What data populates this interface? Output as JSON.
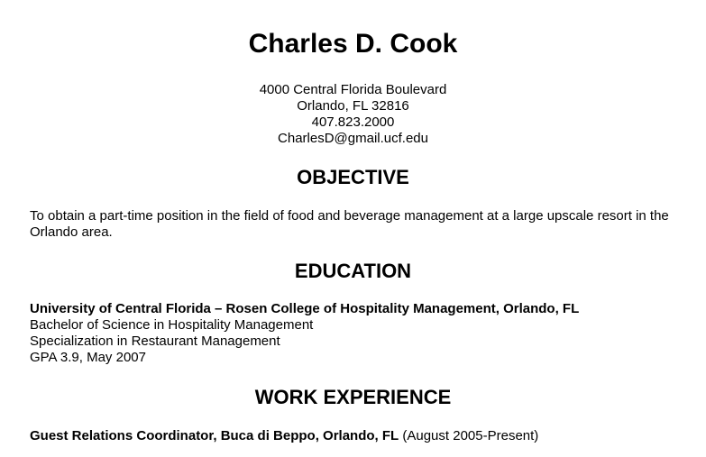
{
  "header": {
    "name": "Charles D. Cook",
    "address_line1": "4000 Central Florida Boulevard",
    "address_line2": "Orlando, FL 32816",
    "phone": "407.823.2000",
    "email": "CharlesD@gmail.ucf.edu"
  },
  "objective": {
    "heading": "OBJECTIVE",
    "text": "To obtain a part-time position in the field of food and beverage management at a large upscale resort in the Orlando area."
  },
  "education": {
    "heading": "EDUCATION",
    "school": "University of Central Florida – Rosen College of Hospitality Management, Orlando, FL",
    "degree": "Bachelor of Science in Hospitality Management",
    "specialization": "Specialization in Restaurant Management",
    "gpa_date": "GPA 3.9, May 2007"
  },
  "work": {
    "heading": "WORK EXPERIENCE",
    "job_title": "Guest Relations Coordinator, Buca di Beppo, Orlando, FL",
    "job_dates": " (August 2005-Present)"
  }
}
